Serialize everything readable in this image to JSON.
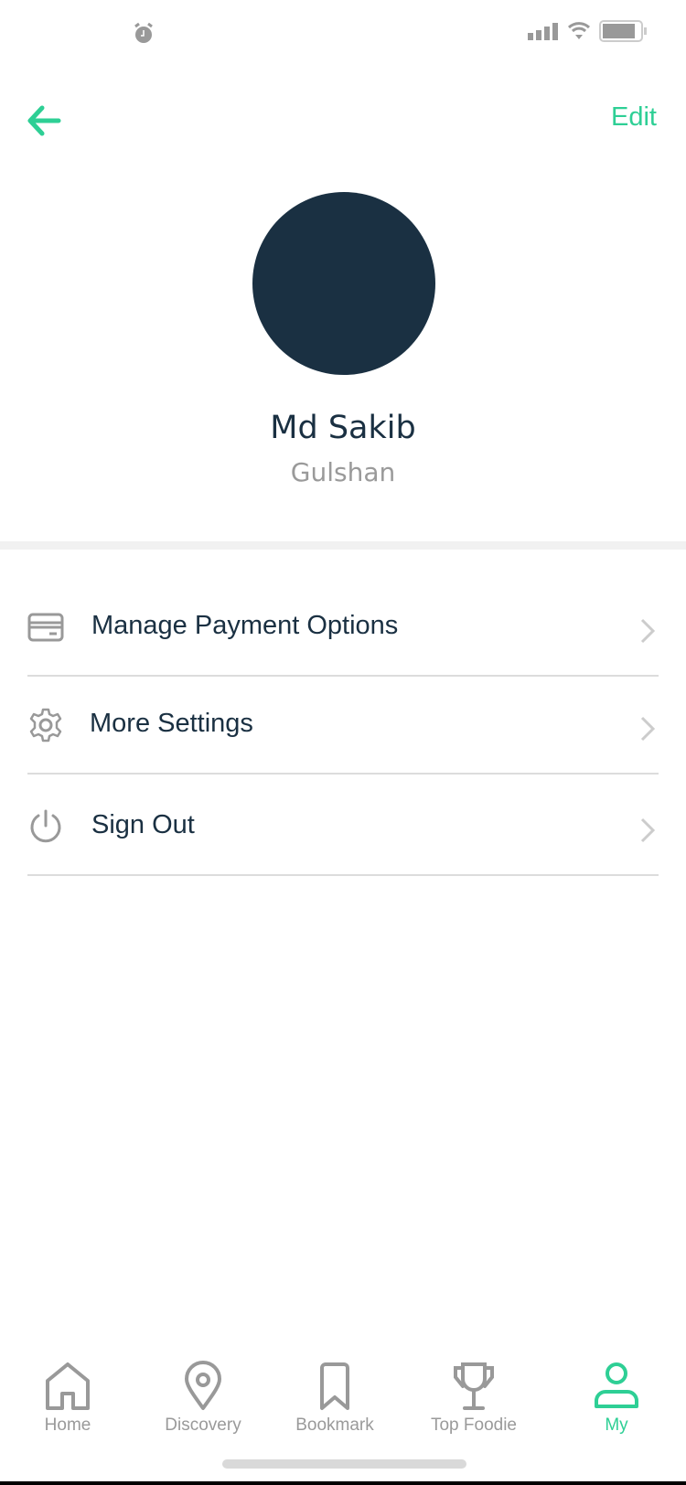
{
  "header": {
    "edit_label": "Edit"
  },
  "profile": {
    "name": "Md Sakib",
    "location": "Gulshan"
  },
  "menu": [
    {
      "label": "Manage Payment Options",
      "icon": "credit-card-icon"
    },
    {
      "label": "More Settings",
      "icon": "gear-icon"
    },
    {
      "label": "Sign Out",
      "icon": "power-icon"
    }
  ],
  "tabs": [
    {
      "label": "Home",
      "icon": "home-icon"
    },
    {
      "label": "Discovery",
      "icon": "location-pin-icon"
    },
    {
      "label": "Bookmark",
      "icon": "bookmark-icon"
    },
    {
      "label": "Top Foodie",
      "icon": "trophy-icon"
    },
    {
      "label": "My",
      "icon": "user-icon",
      "active": true
    }
  ],
  "colors": {
    "accent": "#2ecf95",
    "dark": "#1a3042",
    "gray": "#9a9a9a"
  }
}
